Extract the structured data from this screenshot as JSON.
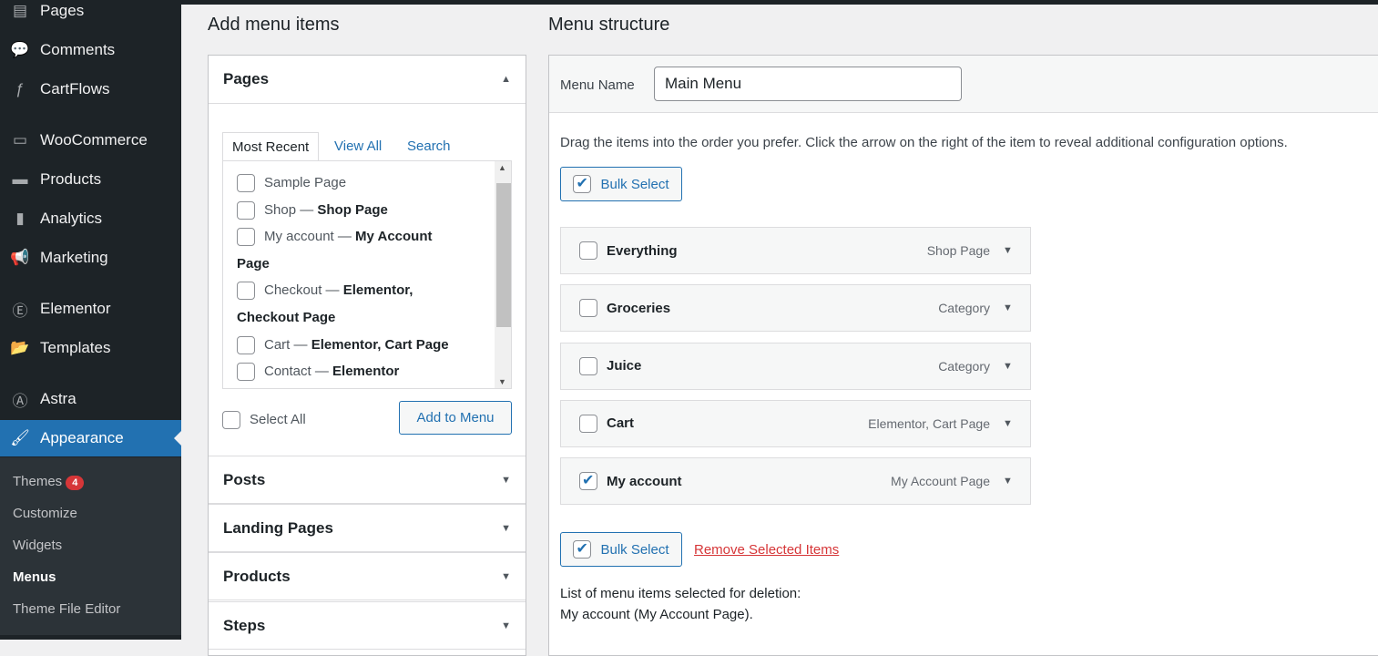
{
  "sidebar": {
    "items": [
      {
        "label": "Pages",
        "icon": "pages-icon",
        "glyph": "▤"
      },
      {
        "label": "Comments",
        "icon": "comment-icon",
        "glyph": "💬"
      },
      {
        "label": "CartFlows",
        "icon": "cartflows-icon",
        "glyph": "ƒ"
      },
      {
        "label": "WooCommerce",
        "icon": "woo-icon",
        "glyph": "▭"
      },
      {
        "label": "Products",
        "icon": "archive-icon",
        "glyph": "▬"
      },
      {
        "label": "Analytics",
        "icon": "bar-chart-icon",
        "glyph": "▮"
      },
      {
        "label": "Marketing",
        "icon": "megaphone-icon",
        "glyph": "📢"
      },
      {
        "label": "Elementor",
        "icon": "elementor-icon",
        "glyph": "Ⓔ"
      },
      {
        "label": "Templates",
        "icon": "folder-icon",
        "glyph": "📂"
      },
      {
        "label": "Astra",
        "icon": "astra-icon",
        "glyph": "Ⓐ"
      },
      {
        "label": "Appearance",
        "icon": "paintbrush-icon",
        "glyph": "🖌"
      }
    ],
    "submenu": [
      {
        "label": "Themes",
        "badge": "4"
      },
      {
        "label": "Customize"
      },
      {
        "label": "Widgets"
      },
      {
        "label": "Menus"
      },
      {
        "label": "Theme File Editor"
      }
    ]
  },
  "add": {
    "title": "Add menu items",
    "pages": "Pages",
    "tabs": [
      "Most Recent",
      "View All",
      "Search"
    ],
    "list": [
      [
        "Sample Page",
        ""
      ],
      [
        "Shop — ",
        "Shop Page"
      ],
      [
        "My account — ",
        "My Account"
      ],
      [
        "",
        "Page"
      ],
      [
        "Checkout — ",
        "Elementor,"
      ],
      [
        "",
        "Checkout Page"
      ],
      [
        "Cart — ",
        "Elementor, Cart Page"
      ],
      [
        "Contact — ",
        "Elementor"
      ]
    ],
    "select_all": "Select All",
    "add_btn": "Add to Menu",
    "sections": [
      "Posts",
      "Landing Pages",
      "Products",
      "Steps"
    ]
  },
  "structure": {
    "title": "Menu structure",
    "menu_name_label": "Menu Name",
    "menu_name": "Main Menu",
    "instructions": "Drag the items into the order you prefer. Click the arrow on the right of the item to reveal additional configuration options.",
    "bulk": "Bulk Select",
    "remove": "Remove Selected Items",
    "items": [
      {
        "title": "Everything",
        "type": "Shop Page",
        "checked": false
      },
      {
        "title": "Groceries",
        "type": "Category",
        "checked": false
      },
      {
        "title": "Juice",
        "type": "Category",
        "checked": false
      },
      {
        "title": "Cart",
        "type": "Elementor, Cart Page",
        "checked": false
      },
      {
        "title": "My account",
        "type": "My Account Page",
        "checked": true
      }
    ],
    "deletion_label": "List of menu items selected for deletion:",
    "deletion_list": "My account (My Account Page)."
  },
  "colors": {
    "accent": "#2271b1",
    "sidebar": "#1d2327",
    "danger": "#d63638"
  }
}
